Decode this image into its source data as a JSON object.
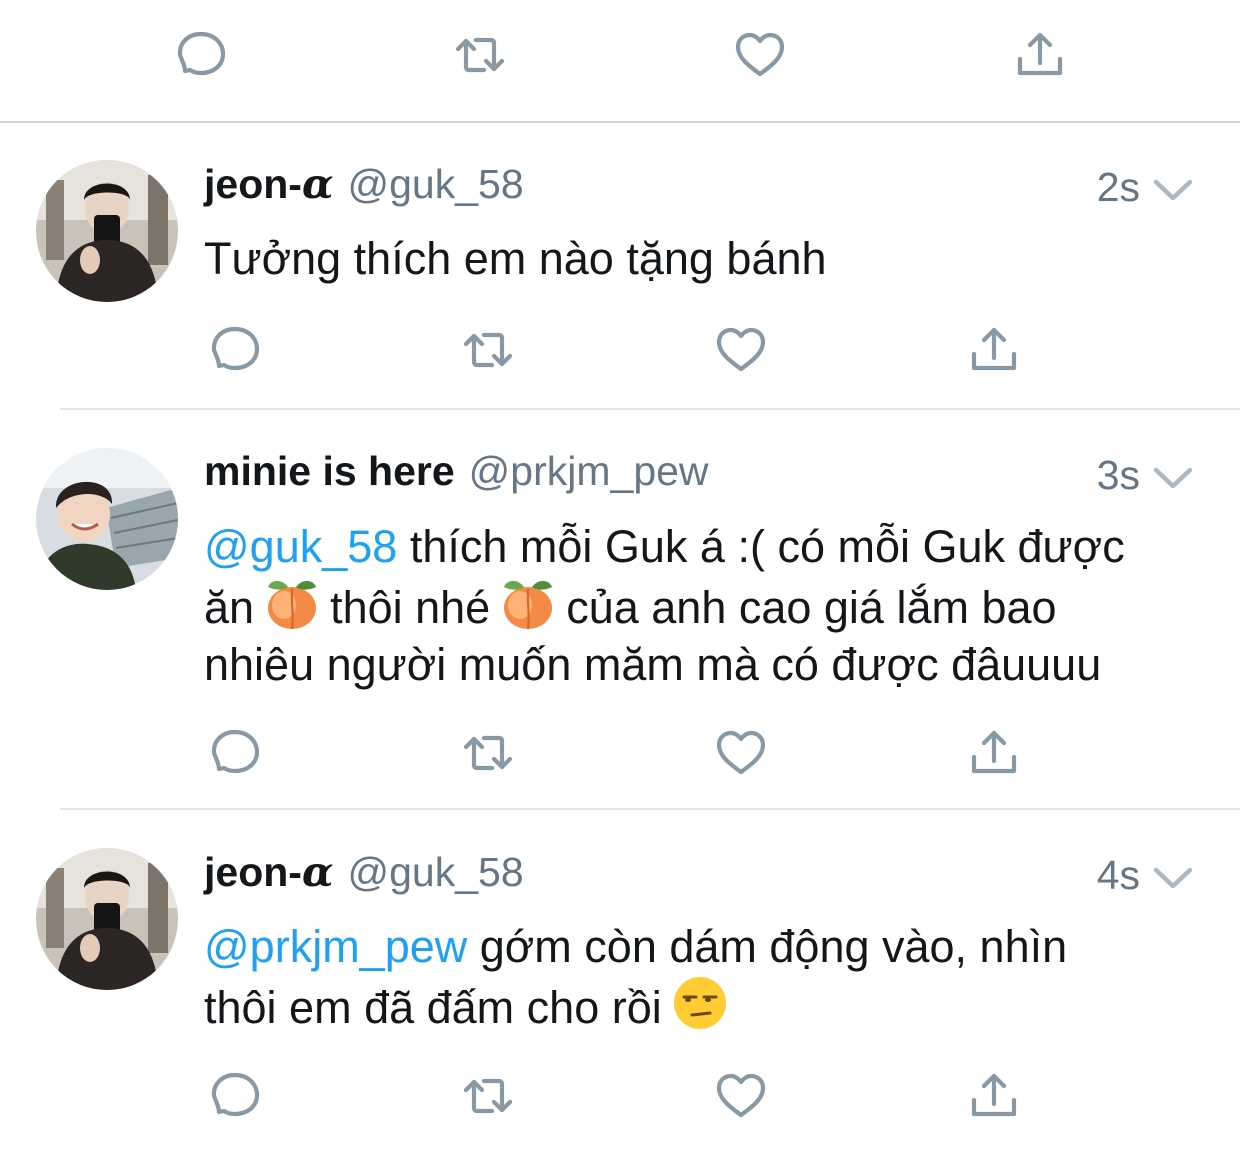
{
  "tweets": [
    {
      "name": "jeon-",
      "name_symbol": "α",
      "handle": "@guk_58",
      "time": "2s",
      "text": "Tưởng thích em nào tặng bánh"
    },
    {
      "name": "minie is here",
      "handle": "@prkjm_pew",
      "time": "3s",
      "mention": "@guk_58",
      "text_1": " thích mỗi Guk á :( có mỗi Guk được",
      "text_2": "ăn",
      "text_3": "thôi nhé",
      "text_4": "của anh cao giá lắm bao",
      "text_5": "nhiêu người muốn măm mà có được đâuuuu",
      "emoji": "peach"
    },
    {
      "name": "jeon-",
      "name_symbol": "α",
      "handle": "@guk_58",
      "time": "4s",
      "mention": "@prkjm_pew",
      "text_1": " gớm còn dám động vào, nhìn",
      "text_2": "thôi em đã đấm cho rồi",
      "emoji": "unamused-face"
    }
  ],
  "icons": [
    "reply-icon",
    "retweet-icon",
    "like-icon",
    "share-icon",
    "chevron-down-icon"
  ],
  "colors": {
    "text": "#14171a",
    "secondary": "#657786",
    "icon": "#8899a6",
    "link": "#1da1f2",
    "divider": "#e1e8ed"
  }
}
